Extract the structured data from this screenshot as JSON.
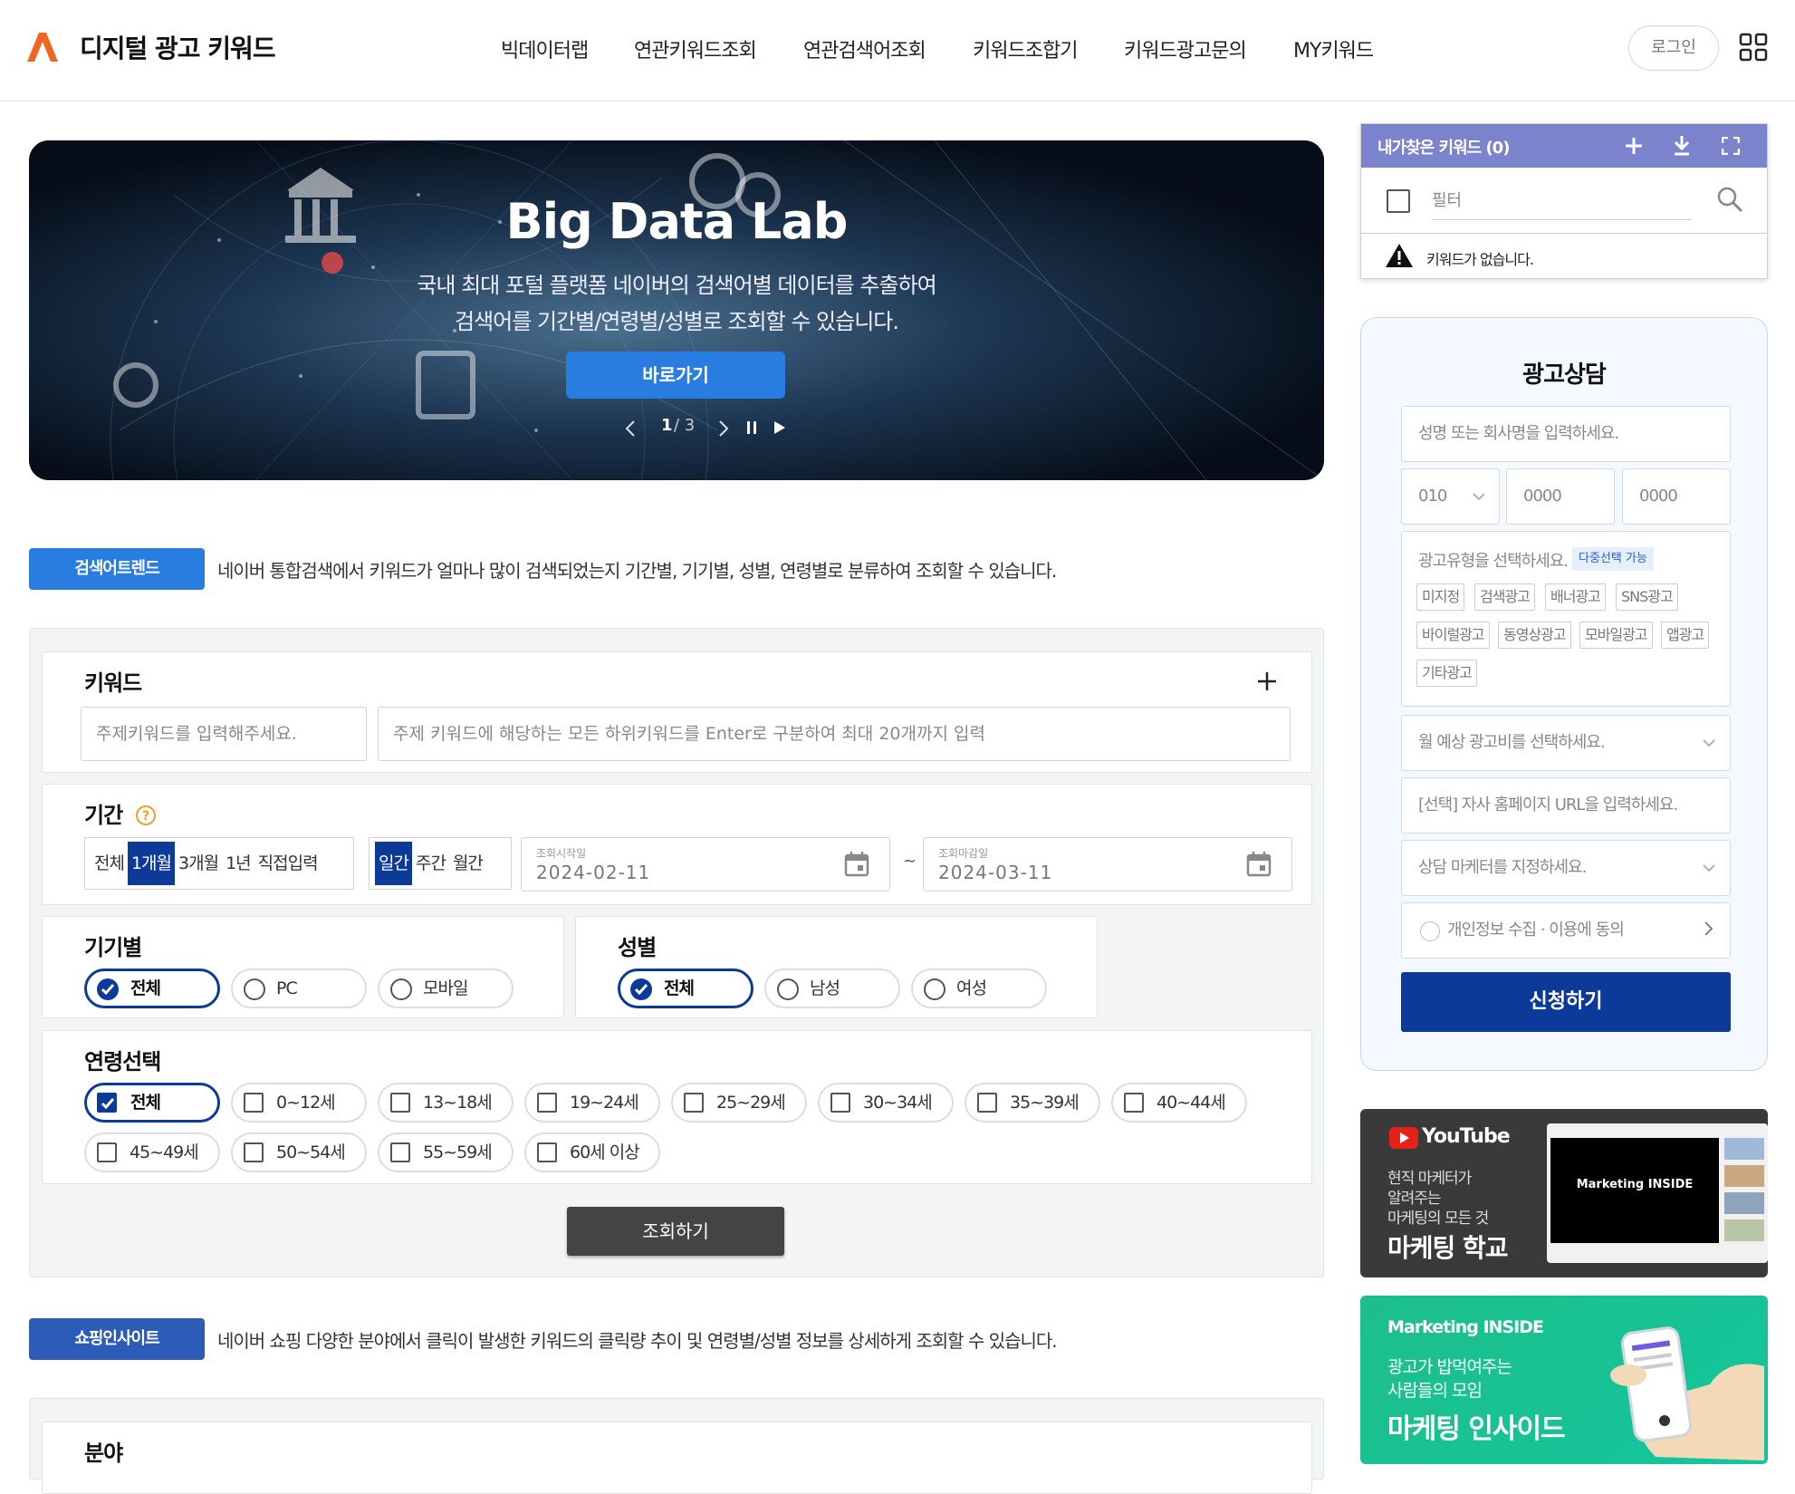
{
  "header": {
    "brand": "디지털 광고 키워드",
    "nav": [
      "빅데이터랩",
      "연관키워드조회",
      "연관검색어조회",
      "키워드조합기",
      "키워드광고문의",
      "MY키워드"
    ],
    "login_label": "로그인"
  },
  "hero": {
    "title": "Big Data Lab",
    "desc_line1": "국내 최대 포털 플랫폼 네이버의 검색어별 데이터를 추출하여",
    "desc_line2": "검색어를 기간별/연령별/성별로 조회할 수 있습니다.",
    "button_label": "바로가기",
    "pager_current": "1",
    "pager_total": "/ 3"
  },
  "search_trend": {
    "badge": "검색어트렌드",
    "badge_color": "#2a7de0",
    "description": "네이버 통합검색에서 키워드가 얼마나 많이 검색되었는지 기간별, 기기별, 성별, 연령별로 분류하여 조회할 수 있습니다."
  },
  "keyword": {
    "title": "키워드",
    "topic_placeholder": "주제키워드를 입력해주세요.",
    "sub_placeholder": "주제 키워드에 해당하는 모든 하위키워드를 Enter로 구분하여 최대 20개까지 입력"
  },
  "period": {
    "title": "기간",
    "ranges": [
      "전체",
      "1개월",
      "3개월",
      "1년",
      "직접입력"
    ],
    "selected_range": "1개월",
    "units": [
      "일간",
      "주간",
      "월간"
    ],
    "selected_unit": "일간",
    "start_label": "조회시작일",
    "start_value": "2024-02-11",
    "tilde": "~",
    "end_label": "조회마감일",
    "end_value": "2024-03-11"
  },
  "device": {
    "title": "기기별",
    "options": [
      "전체",
      "PC",
      "모바일"
    ],
    "selected": "전체"
  },
  "gender": {
    "title": "성별",
    "options": [
      "전체",
      "남성",
      "여성"
    ],
    "selected": "전체"
  },
  "age": {
    "title": "연령선택",
    "options": [
      "전체",
      "0~12세",
      "13~18세",
      "19~24세",
      "25~29세",
      "30~34세",
      "35~39세",
      "40~44세",
      "45~49세",
      "50~54세",
      "55~59세",
      "60세 이상"
    ],
    "selected": "전체"
  },
  "query_button": "조회하기",
  "shopping": {
    "badge": "쇼핑인사이트",
    "badge_color": "#2d5bb8",
    "description": "네이버 쇼핑 다양한 분야에서 클릭이 발생한 키워드의 클릭량 추이 및 연령별/성별 정보를 상세하게 조회할 수 있습니다.",
    "field_title": "분야"
  },
  "favorites": {
    "title": "내가찾은 키워드 (0)",
    "filter_placeholder": "필터",
    "empty_message": "키워드가 없습니다."
  },
  "consult": {
    "title": "광고상담",
    "name_placeholder": "성명 또는 회사명을 입력하세요.",
    "phone_prefix": "010",
    "phone_mid_placeholder": "0000",
    "phone_last_placeholder": "0000",
    "ad_type_label": "광고유형을 선택하세요.",
    "multi_badge": "다중선택 가능",
    "ad_types": [
      "미지정",
      "검색광고",
      "배너광고",
      "SNS광고",
      "바이럴광고",
      "동영상광고",
      "모바일광고",
      "앱광고",
      "기타광고"
    ],
    "budget_placeholder": "월 예상 광고비를 선택하세요.",
    "url_placeholder": "[선택] 자사 홈페이지 URL을 입력하세요.",
    "marketer_placeholder": "상담 마케터를 지정하세요.",
    "privacy_label": "개인정보 수집 · 이용에 동의",
    "apply_label": "신청하기"
  },
  "ads": {
    "youtube": {
      "brand": "YouTube",
      "line1": "현직 마케터가",
      "line2": "알려주는",
      "line3": "마케팅의 모든 것",
      "headline": "마케팅 학교",
      "screen_text": "Marketing INSIDE"
    },
    "inside": {
      "brand": "Marketing INSIDE",
      "line1": "광고가 밥먹여주는",
      "line2": "사람들의 모임",
      "headline": "마케팅 인사이드"
    }
  }
}
